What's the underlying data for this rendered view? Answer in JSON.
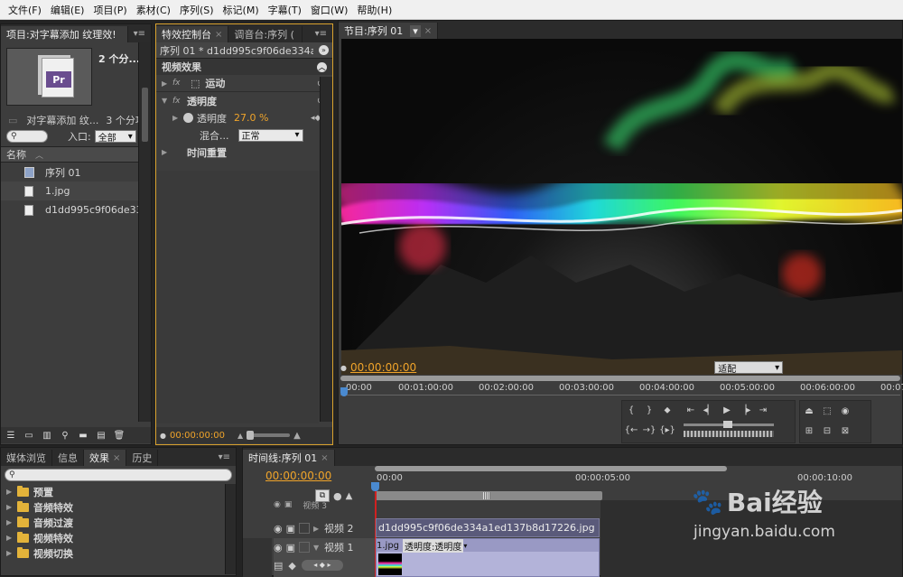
{
  "menu": [
    "文件(F)",
    "编辑(E)",
    "项目(P)",
    "素材(C)",
    "序列(S)",
    "标记(M)",
    "字幕(T)",
    "窗口(W)",
    "帮助(H)"
  ],
  "project": {
    "tab": "项目:对字幕添加 纹理效!",
    "count_top": "2 个分...",
    "name_label": "对字幕添加 纹...",
    "count": "3 个分项",
    "entry_label": "入口:",
    "entry_value": "全部",
    "col_name": "名称",
    "items": [
      "序列 01",
      "1.jpg",
      "d1dd995c9f06de334a1"
    ]
  },
  "effects_ctrl": {
    "tab": "特效控制台",
    "tab2": "调音台:序列 (",
    "seq_title": "序列 01 * d1dd995c9f06de334a1e...",
    "section": "视频效果",
    "motion": "运动",
    "opacity": "透明度",
    "opacity_prop": "透明度",
    "opacity_value": "27.0 %",
    "blend_label": "混合...",
    "blend_value": "正常",
    "time_remap": "时间重置",
    "timecode": "00:00:00:00"
  },
  "program": {
    "tab": "节目:序列 01",
    "timecode": "00:00:00:00",
    "fit": "适配",
    "ruler": [
      "00:00",
      "00:01:00:00",
      "00:02:00:00",
      "00:03:00:00",
      "00:04:00:00",
      "00:05:00:00",
      "00:06:00:00",
      "00:07"
    ]
  },
  "effects_panel": {
    "tabs": [
      "媒体浏览",
      "信息",
      "效果",
      "历史"
    ],
    "folders": [
      "预置",
      "音频特效",
      "音频过渡",
      "视频特效",
      "视频切换"
    ]
  },
  "timeline": {
    "tab": "时间线:序列 01",
    "timecode": "00:00:00:00",
    "ruler": [
      "00:00",
      "00:00:05:00",
      "00:00:10:00"
    ],
    "tracks": [
      "视频 3",
      "视频 2",
      "视频 1"
    ],
    "clip_v2": "d1dd995c9f06de334a1ed137b8d17226.jpg",
    "clip_v1": "1.jpg",
    "clip_v1_prop": "透明度:透明度"
  },
  "watermark": {
    "brand": "Bai经验",
    "url": "jingyan.baidu.com"
  },
  "colors": {
    "accent": "#f0a42a",
    "panel": "#3d3d3d",
    "highlight": "#d9a22e"
  }
}
